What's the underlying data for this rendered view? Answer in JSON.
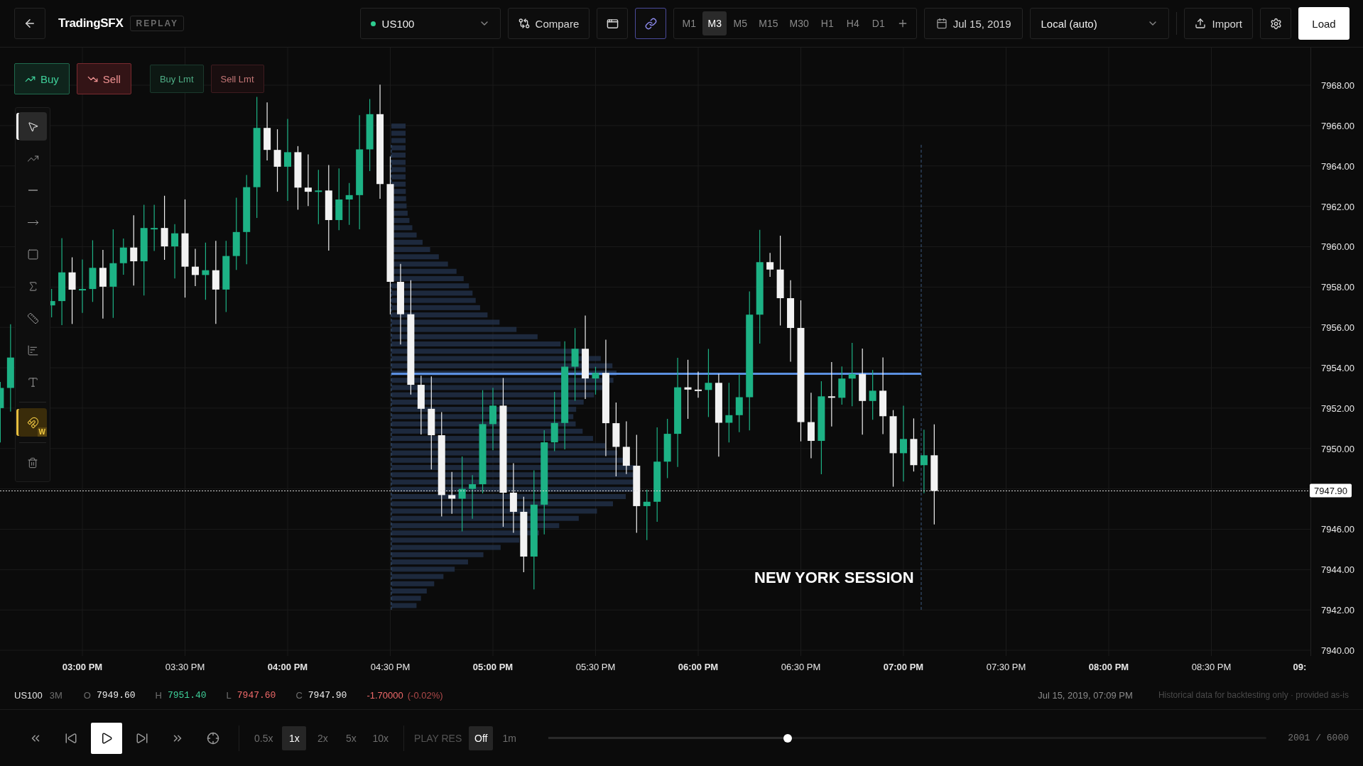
{
  "header": {
    "title": "TradingSFX",
    "badge": "REPLAY",
    "symbol": "US100",
    "compare": "Compare",
    "link": {
      "on": true
    },
    "timeframes": [
      {
        "label": "M1",
        "selected": false
      },
      {
        "label": "M3",
        "selected": true
      },
      {
        "label": "M5",
        "selected": false
      },
      {
        "label": "M15",
        "selected": false
      },
      {
        "label": "M30",
        "selected": false
      },
      {
        "label": "H1",
        "selected": false
      },
      {
        "label": "H4",
        "selected": false
      },
      {
        "label": "D1",
        "selected": false
      }
    ],
    "date": "Jul 15, 2019",
    "timezone": "Local (auto)",
    "import": "Import",
    "load": "Load"
  },
  "orders": [
    {
      "label": "Buy",
      "kind": "buy"
    },
    {
      "label": "Sell",
      "kind": "sell"
    },
    {
      "label": "Buy Lmt",
      "kind": "buy_limit"
    },
    {
      "label": "Sell Lmt",
      "kind": "sell_limit"
    }
  ],
  "tools": [
    {
      "kind": "cursor",
      "selected": true
    },
    {
      "kind": "trend",
      "selected": false
    },
    {
      "kind": "hline",
      "selected": false
    },
    {
      "kind": "arrow",
      "selected": false
    },
    {
      "kind": "rect",
      "selected": false
    },
    {
      "kind": "sigma",
      "selected": false
    },
    {
      "kind": "ruler",
      "selected": false
    },
    {
      "kind": "fib",
      "selected": false
    },
    {
      "kind": "text",
      "selected": false
    }
  ],
  "magnet": {
    "on": true,
    "badge": "W"
  },
  "chart": {
    "session_label": "NEW YORK SESSION",
    "last_price": "7947.90",
    "price_ticks": [
      "7968.00",
      "7966.00",
      "7964.00",
      "7962.00",
      "7960.00",
      "7958.00",
      "7956.00",
      "7954.00",
      "7952.00",
      "7950.00",
      "7946.00",
      "7944.00",
      "7942.00",
      "7940.00"
    ],
    "time_ticks": [
      {
        "label": "03:00 PM",
        "major": true
      },
      {
        "label": "03:30 PM",
        "major": false
      },
      {
        "label": "04:00 PM",
        "major": true
      },
      {
        "label": "04:30 PM",
        "major": false
      },
      {
        "label": "05:00 PM",
        "major": true
      },
      {
        "label": "05:30 PM",
        "major": false
      },
      {
        "label": "06:00 PM",
        "major": true
      },
      {
        "label": "06:30 PM",
        "major": false
      },
      {
        "label": "07:00 PM",
        "major": true
      },
      {
        "label": "07:30 PM",
        "major": false
      },
      {
        "label": "08:00 PM",
        "major": true
      },
      {
        "label": "08:30 PM",
        "major": false
      },
      {
        "label": "09:",
        "major": true
      }
    ]
  },
  "info": {
    "symbol": "US100",
    "interval": "3M",
    "ohlc": [
      {
        "label": "O",
        "value": "7949.60",
        "kind": "neutral"
      },
      {
        "label": "H",
        "value": "7951.40",
        "kind": "up"
      },
      {
        "label": "L",
        "value": "7947.60",
        "kind": "down"
      },
      {
        "label": "C",
        "value": "7947.90",
        "kind": "neutral"
      }
    ],
    "change": "-1.70000",
    "change_pct": "(-0.02%)",
    "timestamp": "Jul 15, 2019, 07:09 PM",
    "disclaimer": "Historical data for backtesting only · provided as-is"
  },
  "playback": {
    "speeds": [
      {
        "label": "0.5x",
        "selected": false
      },
      {
        "label": "1x",
        "selected": true
      },
      {
        "label": "2x",
        "selected": false
      },
      {
        "label": "5x",
        "selected": false
      },
      {
        "label": "10x",
        "selected": false
      }
    ],
    "res_label": "PLAY RES",
    "res": [
      {
        "label": "Off",
        "selected": true
      },
      {
        "label": "1m",
        "selected": false
      }
    ],
    "level": 0.3335,
    "counter": "2001 / 6000"
  }
}
